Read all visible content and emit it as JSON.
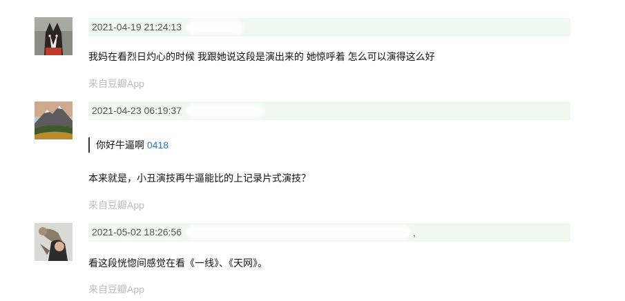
{
  "comments": [
    {
      "timestamp": "2021-04-19 21:24:13",
      "content": "我妈在看烈日灼心的时候 我跟她说这段是演出来的 她惊呼着 怎么可以演得这么好",
      "source": "来自豆瓣App"
    },
    {
      "timestamp": "2021-04-23 06:19:37",
      "quote_text": "你好牛逼啊",
      "quote_ref": "0418",
      "content": "本来就是，小丑演技再牛逼能比的上记录片式演技？",
      "source": "来自豆瓣App"
    },
    {
      "timestamp": "2021-05-02 18:26:56",
      "trailing": ",",
      "content": "看这段恍惚间感觉在看《一线》、《天网》。",
      "source": "来自豆瓣App"
    }
  ],
  "avatar_icons": [
    "dog-avatar-icon",
    "mountain-avatar-icon",
    "person-cat-avatar-icon"
  ],
  "colors": {
    "meta_bg": "#f0f9ef",
    "source": "#bdbdbd",
    "link": "#3377aa"
  }
}
